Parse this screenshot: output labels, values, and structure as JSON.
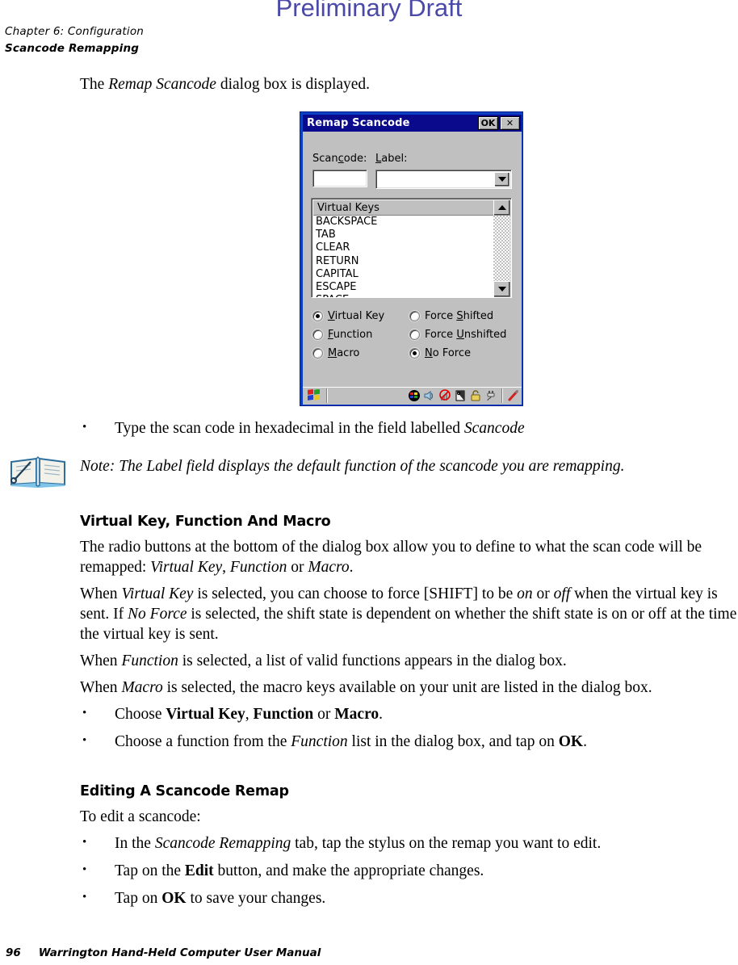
{
  "watermark": "Preliminary Draft",
  "running_header": {
    "chapter": "Chapter 6:  Configuration",
    "section": "Scancode Remapping"
  },
  "intro": {
    "lead_before": "The ",
    "lead_italic": "Remap Scancode",
    "lead_after": " dialog box is displayed."
  },
  "dialog": {
    "title": "Remap Scancode",
    "ok_label": "OK",
    "close_label": "✕",
    "fields": {
      "scancode_label": "Scancode:",
      "scancode_value": "",
      "label_label": "Label:",
      "label_value": ""
    },
    "listbox": {
      "header": "Virtual Keys",
      "items": [
        "BACKSPACE",
        "TAB",
        "CLEAR",
        "RETURN",
        "CAPITAL",
        "ESCAPE",
        "SPACE"
      ],
      "scroll_up_icon": "triangle-up-icon",
      "scroll_down_icon": "triangle-down-icon"
    },
    "radios": {
      "left": [
        {
          "label": "Virtual Key",
          "selected": true
        },
        {
          "label": "Function",
          "selected": false
        },
        {
          "label": "Macro",
          "selected": false
        }
      ],
      "right": [
        {
          "label": "Force Shifted",
          "selected": false
        },
        {
          "label": "Force Unshifted",
          "selected": false
        },
        {
          "label": "No Force",
          "selected": true
        }
      ]
    },
    "taskbar": {
      "start_icon": "windows-start-flag-icon",
      "tray_icons": [
        "color-wheel-icon",
        "speaker-volume-icon",
        "no-signal-icon",
        "storage-card-icon",
        "padlock-icon",
        "power-plug-icon",
        "stylus-pen-icon"
      ]
    }
  },
  "bullet_type_scancode": {
    "before": "Type the scan code in hexadecimal in the field labelled ",
    "italic": "Scancode"
  },
  "note": {
    "icon": "open-book-note-icon",
    "text": "Note: The Label field displays the default function of the scancode you are remapping."
  },
  "section_vkfm": {
    "heading": "Virtual Key, Function And Macro",
    "p1_a": "The radio buttons at the bottom of the dialog box allow you to define to what the scan code will be remapped: ",
    "p1_i1": "Virtual Key",
    "p1_b": ", ",
    "p1_i2": "Function",
    "p1_c": " or ",
    "p1_i3": "Macro",
    "p1_d": ".",
    "p2_a": "When ",
    "p2_i1": "Virtual Key",
    "p2_b": " is selected, you can choose to force [SHIFT] to be ",
    "p2_i2": "on",
    "p2_c": " or ",
    "p2_i3": "off",
    "p2_d": " when the virtual key is sent. If ",
    "p2_i4": "No Force",
    "p2_e": " is selected, the shift state is dependent on whether the shift state is on or off at the time the virtual key is sent.",
    "p3_a": "When ",
    "p3_i1": "Function",
    "p3_b": " is selected, a list of valid functions appears in the dialog box.",
    "p4_a": "When ",
    "p4_i1": "Macro",
    "p4_b": " is selected, the macro keys available on your unit are listed in the dialog box.",
    "b1_a": "Choose ",
    "b1_b1": "Virtual Key",
    "b1_b": ", ",
    "b1_b2": "Function",
    "b1_c": " or ",
    "b1_b3": "Macro",
    "b1_d": ".",
    "b2_a": "Choose a function from the ",
    "b2_i1": "Function",
    "b2_b": " list in the dialog box, and tap on ",
    "b2_b1": "OK",
    "b2_c": "."
  },
  "section_editing": {
    "heading": "Editing A Scancode Remap",
    "lead": "To edit a scancode:",
    "b1_a": "In the ",
    "b1_i1": "Scancode Remapping",
    "b1_b": " tab, tap the stylus on the remap you want to edit.",
    "b2_a": "Tap on the ",
    "b2_b1": "Edit",
    "b2_b": " button, and make the appropriate changes.",
    "b3_a": "Tap on ",
    "b3_b1": "OK",
    "b3_b": " to save your changes."
  },
  "footer": {
    "page_number": "96",
    "manual_title": "Warrington Hand-Held Computer User Manual"
  },
  "colors": {
    "watermark": "#4a49a8",
    "dialog_border": "#0b3fc4",
    "titlebar": "#0a0a8c",
    "face": "#c0c0c0"
  }
}
